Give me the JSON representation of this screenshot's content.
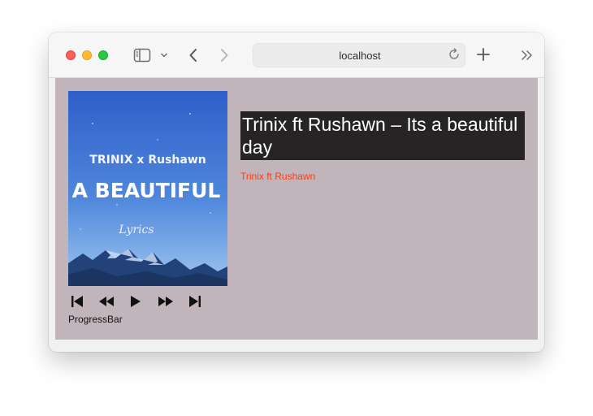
{
  "browser": {
    "address": "localhost"
  },
  "album": {
    "art_top_text": "TRINIX x Rushawn",
    "art_main_text": "A BEAUTIFUL",
    "art_script_text": "Lyrics"
  },
  "player": {
    "title": "Trinix ft Rushawn – Its a beautiful day",
    "artist": "Trinix ft Rushawn",
    "progress_label": "ProgressBar"
  },
  "colors": {
    "page_bg": "#c1b5bb",
    "title_bg": "#262425",
    "artist_color": "#ff3b12"
  },
  "icons": [
    "sidebar-icon",
    "chevron-down-icon",
    "back-icon",
    "forward-icon",
    "reload-icon",
    "plus-icon",
    "double-chevron-icon",
    "skip-back-icon",
    "rewind-icon",
    "play-icon",
    "fast-forward-icon",
    "skip-forward-icon"
  ]
}
